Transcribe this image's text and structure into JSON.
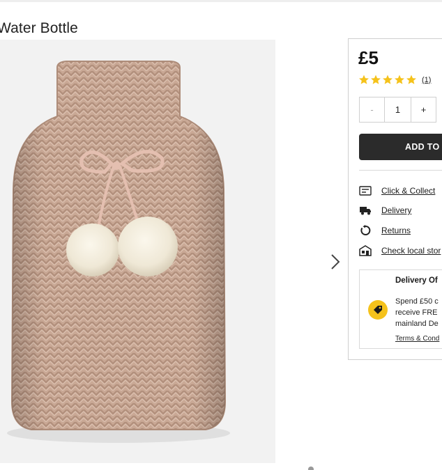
{
  "product": {
    "title": "Water Bottle",
    "image_alt": "Knitted hot water bottle cover with pom-poms"
  },
  "gallery": {
    "next_icon": "chevron-right-icon"
  },
  "buy_box": {
    "price": "£5",
    "rating": {
      "stars": 5,
      "max": 5,
      "review_count": "(1)",
      "star_color": "#f5c21b"
    },
    "quantity": {
      "minus": "-",
      "value": "1",
      "plus": "+"
    },
    "add_to_bag": "ADD TO",
    "services": [
      {
        "label": "Click & Collect",
        "icon": "collect-icon"
      },
      {
        "label": "Delivery",
        "icon": "delivery-truck-icon"
      },
      {
        "label": "Returns",
        "icon": "returns-icon"
      },
      {
        "label": "Check local stor",
        "icon": "store-icon"
      }
    ],
    "delivery_offer": {
      "title": "Delivery Of",
      "text": "Spend £50 c\nreceive FRE\nmainland De",
      "terms": "Terms & Cond",
      "badge_icon": "price-tag-icon",
      "badge_color": "#f5c21b"
    }
  }
}
